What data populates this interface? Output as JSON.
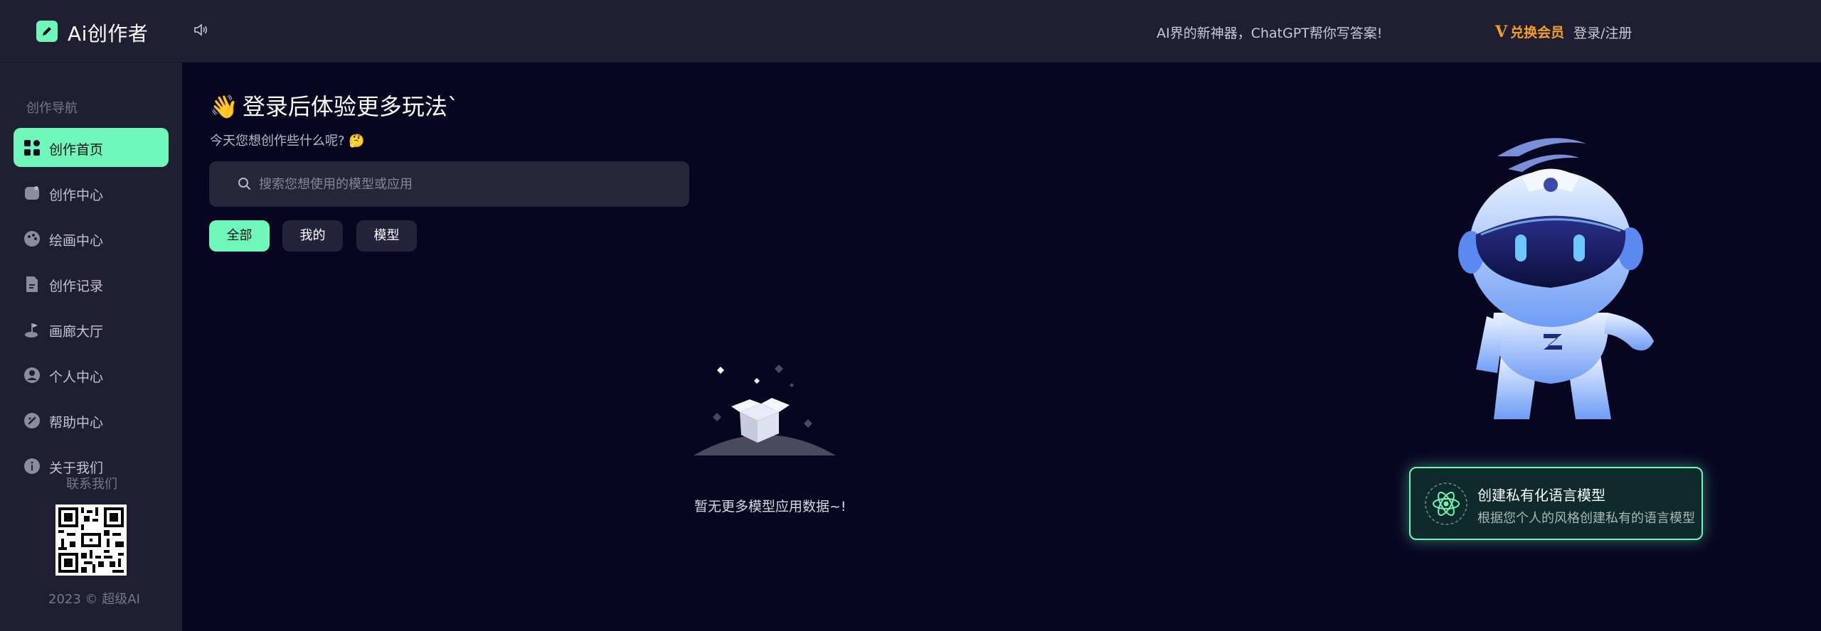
{
  "header": {
    "app_name": "Ai创作者",
    "slogan": "AI界的新神器，ChatGPT帮你写答案!",
    "vip_label": "兑换会员",
    "vip_prefix": "V",
    "login_label": "登录/注册"
  },
  "sidebar": {
    "nav_title": "创作导航",
    "items": [
      {
        "label": "创作首页",
        "icon": "grid-icon",
        "active": true
      },
      {
        "label": "创作中心",
        "icon": "chat-icon"
      },
      {
        "label": "绘画中心",
        "icon": "palette-icon"
      },
      {
        "label": "创作记录",
        "icon": "document-icon"
      },
      {
        "label": "画廊大厅",
        "icon": "gallery-icon"
      },
      {
        "label": "个人中心",
        "icon": "user-icon"
      },
      {
        "label": "帮助中心",
        "icon": "help-icon"
      },
      {
        "label": "关于我们",
        "icon": "info-icon"
      }
    ],
    "contact_title": "联系我们",
    "copyright": "2023 © 超级AI"
  },
  "main": {
    "title": "登录后体验更多玩法`",
    "title_emoji": "👋",
    "subtitle": "今天您想创作些什么呢?",
    "subtitle_emoji": "🤔",
    "search": {
      "placeholder": "搜索您想使用的模型或应用",
      "value": ""
    },
    "tabs": [
      {
        "label": "全部",
        "active": true
      },
      {
        "label": "我的"
      },
      {
        "label": "模型"
      }
    ],
    "empty_text": "暂无更多模型应用数据~!"
  },
  "promo": {
    "title": "创建私有化语言模型",
    "description": "根据您个人的风格创建私有的语言模型"
  },
  "colors": {
    "accent": "#6ff7b9",
    "vip": "#f4a020",
    "background": "#070620",
    "panel": "#1f1e33"
  }
}
